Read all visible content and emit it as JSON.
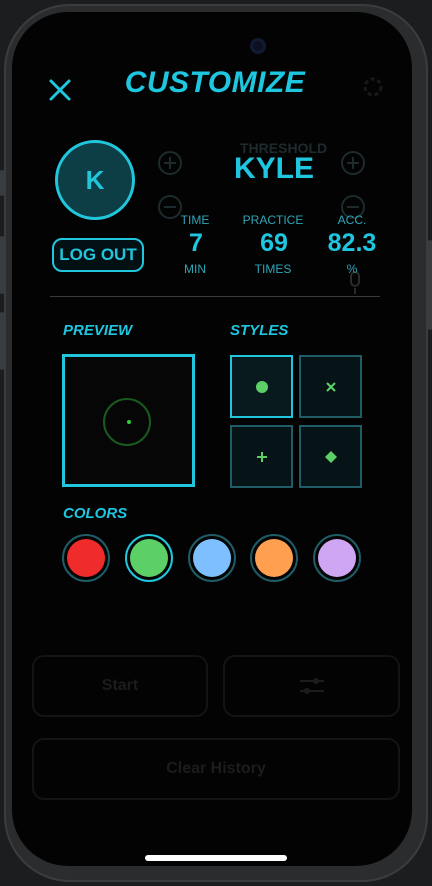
{
  "header": {
    "title": "CUSTOMIZE"
  },
  "profile": {
    "avatar_initial": "K",
    "name": "KYLE",
    "logout_label": "LOG OUT"
  },
  "stats": [
    {
      "label": "TIME",
      "value": "7",
      "unit": "MIN"
    },
    {
      "label": "PRACTICE",
      "value": "69",
      "unit": "TIMES"
    },
    {
      "label": "ACC.",
      "value": "82.3",
      "unit": "%"
    }
  ],
  "background": {
    "threshold_label": "THRESHOLD",
    "start_label": "Start",
    "clear_history_label": "Clear History"
  },
  "preview": {
    "label": "PREVIEW",
    "dot_color": "#2ecc40"
  },
  "styles": {
    "label": "STYLES",
    "items": [
      {
        "icon": "dot-icon",
        "selected": true
      },
      {
        "icon": "x-icon",
        "selected": false
      },
      {
        "icon": "plus-icon",
        "selected": false
      },
      {
        "icon": "diamond-icon",
        "selected": false
      }
    ]
  },
  "colors": {
    "label": "COLORS",
    "items": [
      {
        "name": "red",
        "hex": "#ef2b2b",
        "selected": false
      },
      {
        "name": "green",
        "hex": "#5cd067",
        "selected": true
      },
      {
        "name": "blue",
        "hex": "#7ec0ff",
        "selected": false
      },
      {
        "name": "orange",
        "hex": "#ff9f4f",
        "selected": false
      },
      {
        "name": "purple",
        "hex": "#cfa6f4",
        "selected": false
      }
    ]
  },
  "theme": {
    "accent": "#1ec6e0",
    "background": "#030303"
  }
}
